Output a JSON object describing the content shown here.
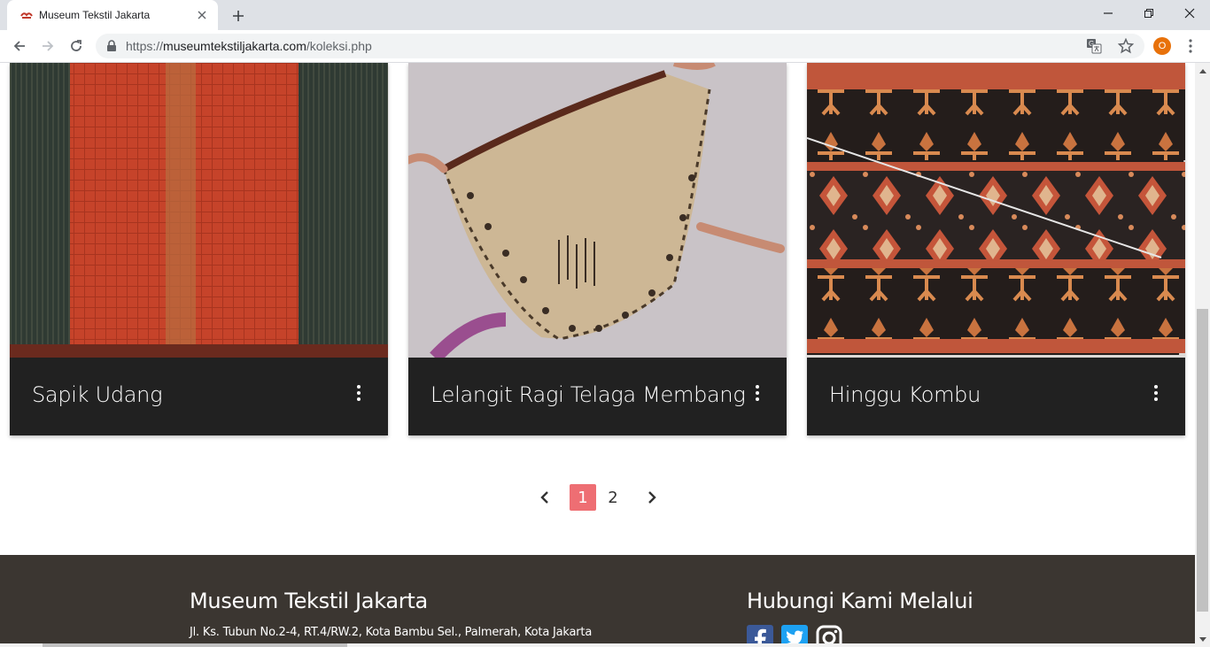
{
  "browser": {
    "tab_title": "Museum Tekstil Jakarta",
    "url_scheme": "https://",
    "url_host": "museumtekstiljakarta.com",
    "url_path": "/koleksi.php",
    "profile_initial": "O"
  },
  "collection": {
    "cards": [
      {
        "title": "Sapik Udang",
        "icon": "more-vert-icon"
      },
      {
        "title": "Lelangit Ragi Telaga Membang",
        "icon": "more-vert-icon"
      },
      {
        "title": "Hinggu Kombu",
        "icon": "more-vert-icon"
      }
    ]
  },
  "pagination": {
    "pages": [
      "1",
      "2"
    ],
    "current": "1"
  },
  "footer": {
    "museum_name": "Museum Tekstil Jakarta",
    "address": "Jl. Ks. Tubun No.2-4, RT.4/RW.2, Kota Bambu Sel., Palmerah, Kota Jakarta",
    "contact_title": "Hubungi Kami Melalui",
    "social": [
      "facebook-icon",
      "twitter-icon",
      "instagram-icon"
    ]
  },
  "colors": {
    "card_footer": "#212121",
    "pagination_active": "#ee6e73",
    "footer_bg": "#3b3631",
    "facebook": "#3b5998",
    "twitter": "#1da1f2"
  }
}
